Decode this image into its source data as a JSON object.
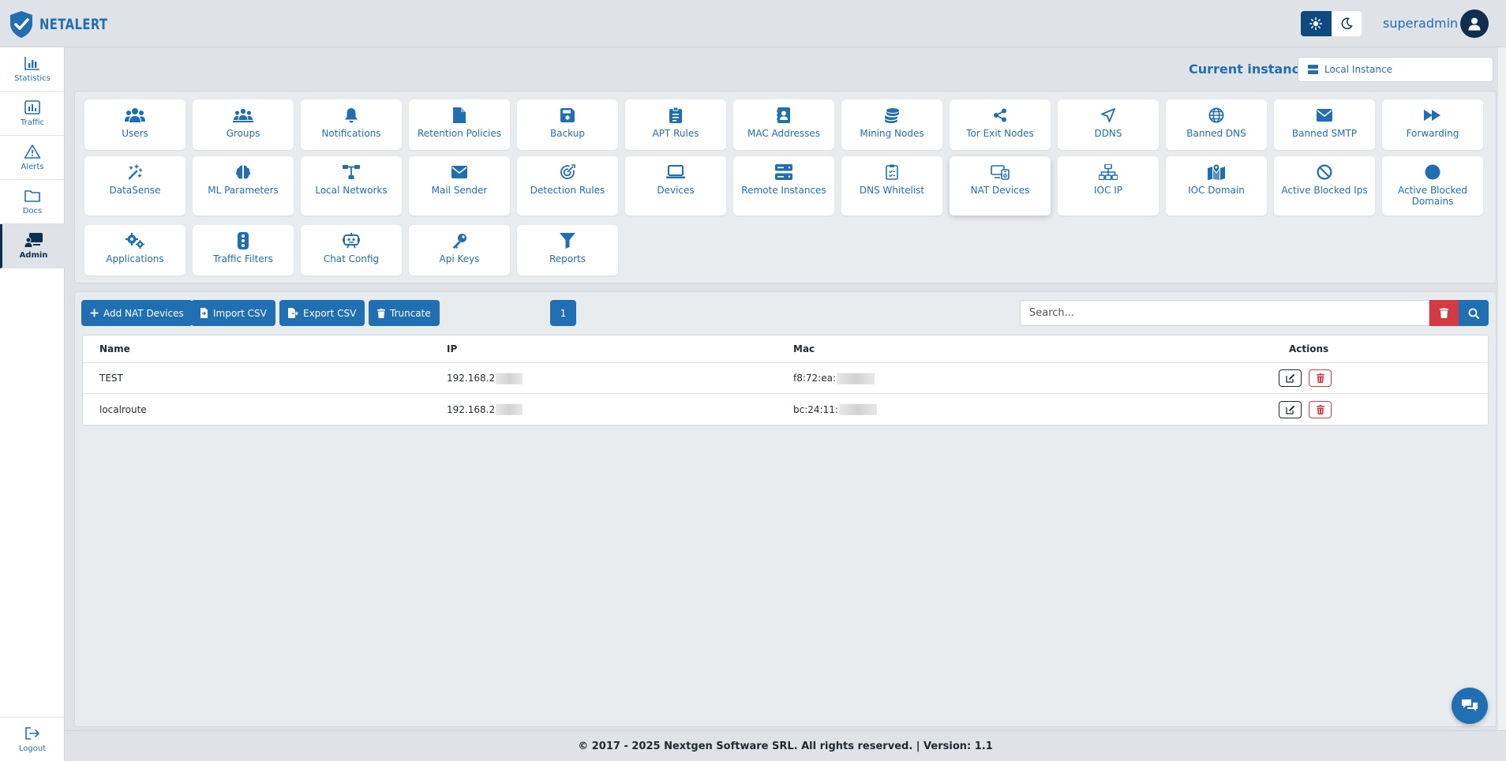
{
  "app": {
    "brand": "NETALERT"
  },
  "header": {
    "username": "superadmin"
  },
  "sidebar": {
    "items": [
      {
        "label": "Statistics",
        "icon": "chart-bar-icon"
      },
      {
        "label": "Traffic",
        "icon": "chart-column-icon"
      },
      {
        "label": "Alerts",
        "icon": "warning-icon"
      },
      {
        "label": "Docs",
        "icon": "folder-icon"
      },
      {
        "label": "Admin",
        "icon": "admin-screen-icon",
        "active": true
      },
      {
        "label": "Logout",
        "icon": "logout-icon"
      }
    ]
  },
  "instance": {
    "label": "Current instance:",
    "value": "Local Instance"
  },
  "tiles": [
    {
      "label": "Users",
      "icon": "users-icon"
    },
    {
      "label": "Groups",
      "icon": "groups-icon"
    },
    {
      "label": "Notifications",
      "icon": "bell-icon"
    },
    {
      "label": "Retention Policies",
      "icon": "file-icon"
    },
    {
      "label": "Backup",
      "icon": "floppy-icon"
    },
    {
      "label": "APT Rules",
      "icon": "clipboard-icon"
    },
    {
      "label": "MAC Addresses",
      "icon": "address-book-icon"
    },
    {
      "label": "Mining Nodes",
      "icon": "coins-icon"
    },
    {
      "label": "Tor Exit Nodes",
      "icon": "share-nodes-icon"
    },
    {
      "label": "DDNS",
      "icon": "location-arrow-icon"
    },
    {
      "label": "Banned DNS",
      "icon": "globe-icon"
    },
    {
      "label": "Banned SMTP",
      "icon": "envelope-icon"
    },
    {
      "label": "Forwarding",
      "icon": "forward-icon"
    },
    {
      "label": "DataSense",
      "icon": "wand-sparkles-icon"
    },
    {
      "label": "ML Parameters",
      "icon": "brain-icon"
    },
    {
      "label": "Local Networks",
      "icon": "network-wired-icon"
    },
    {
      "label": "Mail Sender",
      "icon": "envelope-icon"
    },
    {
      "label": "Detection Rules",
      "icon": "bullseye-icon"
    },
    {
      "label": "Devices",
      "icon": "laptop-icon"
    },
    {
      "label": "Remote Instances",
      "icon": "server-icon"
    },
    {
      "label": "DNS Whitelist",
      "icon": "clipboard-check-icon"
    },
    {
      "label": "NAT Devices",
      "icon": "computer-devices-icon",
      "active": true
    },
    {
      "label": "IOC IP",
      "icon": "sitemap-icon"
    },
    {
      "label": "IOC Domain",
      "icon": "map-location-icon"
    },
    {
      "label": "Active Blocked Ips",
      "icon": "ban-icon"
    },
    {
      "label": "Active Blocked Domains",
      "icon": "circle-icon"
    },
    {
      "label": "Applications",
      "icon": "gears-icon"
    },
    {
      "label": "Traffic Filters",
      "icon": "traffic-light-icon"
    },
    {
      "label": "Chat Config",
      "icon": "robot-icon"
    },
    {
      "label": "Api Keys",
      "icon": "key-icon"
    },
    {
      "label": "Reports",
      "icon": "filter-icon"
    }
  ],
  "toolbar": {
    "add": "Add NAT Devices",
    "import": "Import CSV",
    "export": "Export CSV",
    "truncate": "Truncate",
    "page": "1"
  },
  "search": {
    "placeholder": "Search..."
  },
  "table": {
    "headers": {
      "name": "Name",
      "ip": "IP",
      "mac": "Mac",
      "actions": "Actions"
    },
    "rows": [
      {
        "name": "TEST",
        "ip": "192.168.2",
        "mac": "f8:72:ea:"
      },
      {
        "name": "localroute",
        "ip": "192.168.2",
        "mac": "bc:24:11:"
      }
    ]
  },
  "footer": {
    "text": "© 2017 - 2025 Nextgen Software SRL. All rights reserved. | Version: 1.1"
  },
  "colors": {
    "primary": "#1f6fb2",
    "dark": "#0e2f4f",
    "danger": "#d33a44",
    "background": "#dfe3e8"
  }
}
